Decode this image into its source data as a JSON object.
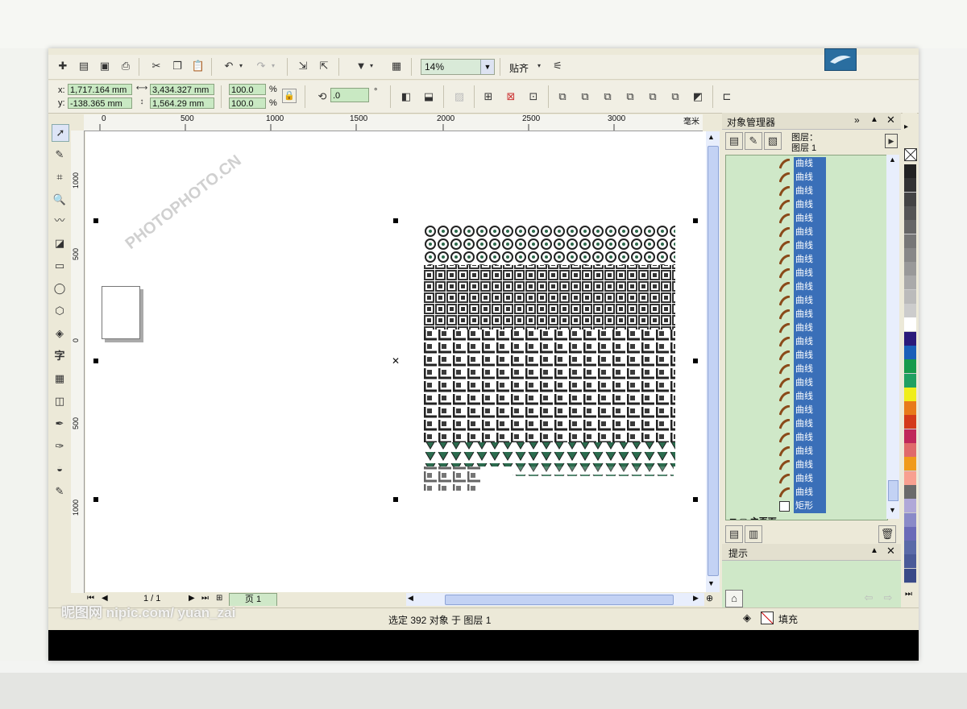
{
  "toolbar": {
    "zoom_value": "14%",
    "snap_label": "贴齐"
  },
  "propertybar": {
    "x_label": "x:",
    "y_label": "y:",
    "x_value": "1,717.164 mm",
    "y_value": "-138.365 mm",
    "width_value": "3,434.327 mm",
    "height_value": "1,564.29 mm",
    "scale_x": "100.0",
    "scale_y": "100.0",
    "percent": "%",
    "rotation_value": ".0",
    "degree": "°"
  },
  "ruler": {
    "unit": "毫米",
    "h_ticks": [
      "0",
      "500",
      "1000",
      "1500",
      "2000",
      "2500",
      "3000"
    ],
    "v_ticks": [
      "1000",
      "500",
      "0",
      "500",
      "1000"
    ]
  },
  "docker": {
    "title": "对象管理器",
    "layer_label": "图层：",
    "layer_name": "图层 1",
    "curve_label": "曲线",
    "rect_label": "矩形",
    "master_page": "主页面",
    "curve_count": 25,
    "hint_title": "提示"
  },
  "pagebar": {
    "page_count": "1 / 1",
    "page_tab": "页 1"
  },
  "status": {
    "selection": "选定 392 对象 于 图层 1",
    "fill_label": "填充"
  },
  "watermark": {
    "site": "昵图网 nipic.com/ yuan_zai",
    "brand": "PHOTOPHOTO.CN"
  },
  "palette_colors": [
    "#222222",
    "#333333",
    "#444444",
    "#555555",
    "#666666",
    "#777777",
    "#888888",
    "#999999",
    "#aaaaaa",
    "#bbbbbb",
    "#cccccc",
    "#ffffff",
    "#2a1a7a",
    "#1a5fb8",
    "#179a4a",
    "#20a060",
    "#f0ee1a",
    "#e87a1a",
    "#d43a1a",
    "#c0285a",
    "#e06a6a",
    "#f09a1a",
    "#f8a090",
    "#6a6a6a",
    "#b0a8d8",
    "#8a8ac8",
    "#6a6ab8",
    "#5a6aa8",
    "#4a5a98",
    "#3a4a88"
  ]
}
